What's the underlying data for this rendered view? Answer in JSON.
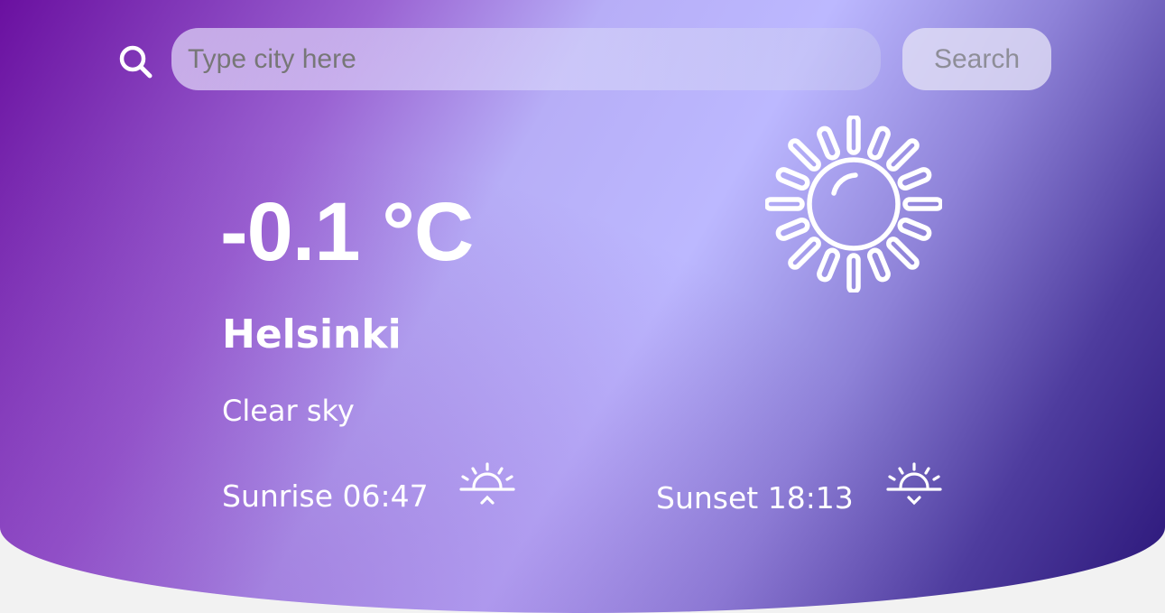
{
  "search": {
    "placeholder": "Type city here",
    "button_label": "Search"
  },
  "weather": {
    "temperature": "-0.1 °C",
    "city": "Helsinki",
    "description": "Clear sky",
    "icon": "sun-icon"
  },
  "sun_times": {
    "sunrise": "Sunrise 06:47",
    "sunset": "Sunset 18:13",
    "sunrise_icon": "sunrise-icon",
    "sunset_icon": "sunset-icon"
  },
  "colors": {
    "gradient_dark_purple": "#6a10a0",
    "gradient_lavender": "#bcb8ff",
    "gradient_deep_indigo": "#2a1578",
    "text": "#ffffff"
  }
}
